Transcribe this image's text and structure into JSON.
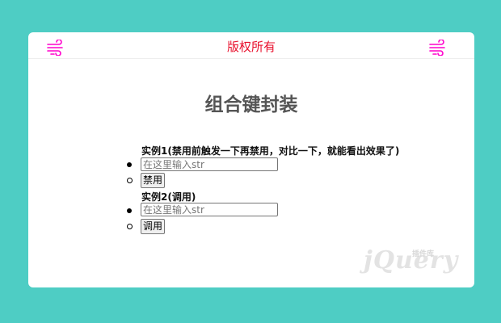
{
  "header": {
    "copyright": "版权所有",
    "left_icon": "wind-icon",
    "right_icon": "wind-icon",
    "icon_color": "#ff00cc"
  },
  "main": {
    "title": "组合键封装",
    "example1": {
      "label": "实例1(禁用前触发一下再禁用，对比一下，就能看出效果了)",
      "input_placeholder": "在这里输入str",
      "button_label": "禁用"
    },
    "example2": {
      "label": "实例2(调用)",
      "input_placeholder": "在这里输入str",
      "button_label": "调用"
    }
  },
  "watermark": {
    "text": "jQuery",
    "sub": "插件库"
  },
  "colors": {
    "background": "#4ecdc4",
    "card": "#ffffff",
    "copyright": "#e8112d"
  }
}
